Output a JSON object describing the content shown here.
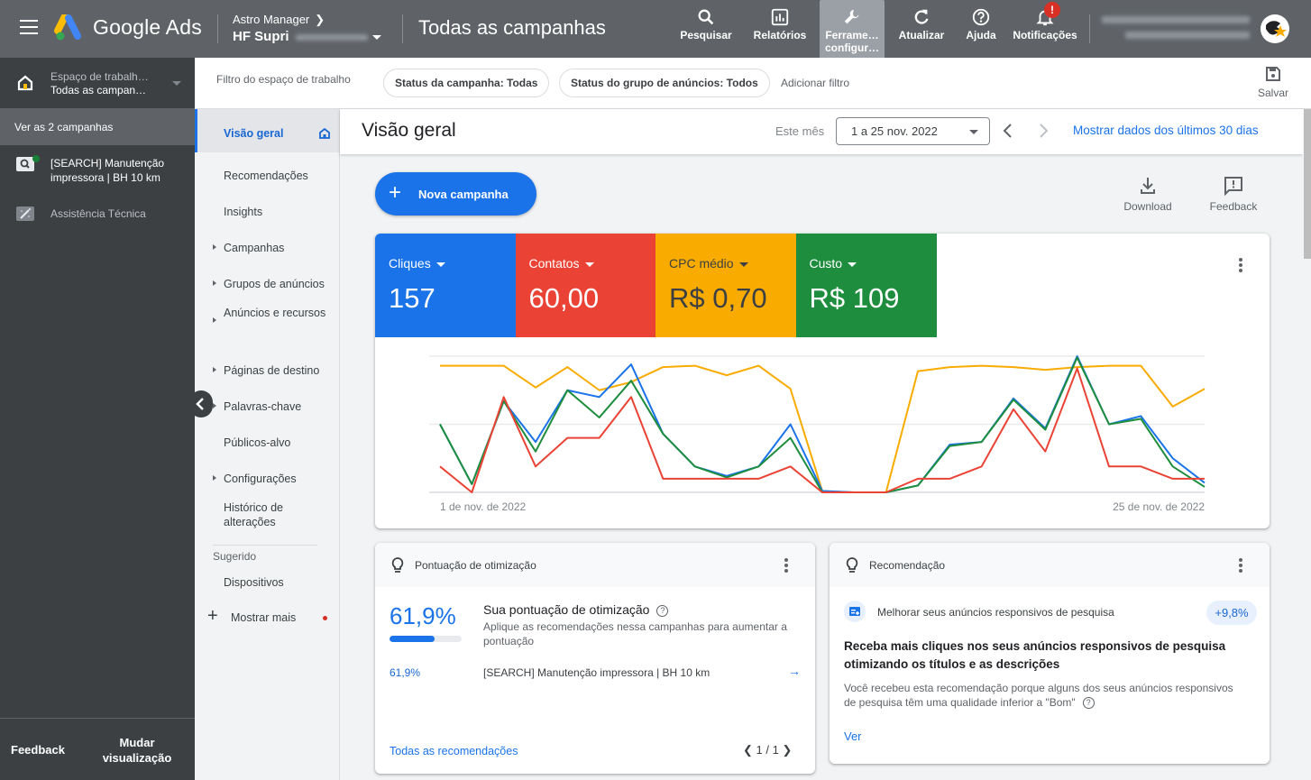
{
  "topbar": {
    "brand": "Google Ads",
    "account_manager": "Astro Manager",
    "account_name": "HF Supri",
    "page_title": "Todas as campanhas",
    "tools": [
      {
        "id": "search",
        "label": "Pesquisar",
        "icon": "search-icon"
      },
      {
        "id": "reports",
        "label": "Relatórios",
        "icon": "bar-chart-icon"
      },
      {
        "id": "tools",
        "label": "Ferrame…",
        "label2": "configur…",
        "icon": "wrench-icon",
        "active": true
      },
      {
        "id": "refresh",
        "label": "Atualizar",
        "icon": "refresh-icon"
      },
      {
        "id": "help",
        "label": "Ajuda",
        "icon": "help-icon"
      },
      {
        "id": "notifications",
        "label": "Notificações",
        "icon": "bell-icon",
        "badge": "!"
      }
    ]
  },
  "leftnav": {
    "workspace_label": "Espaço de trabalh…",
    "workspace_value": "Todas as campan…",
    "all_campaigns": "Ver as 2 campanhas",
    "campaigns": [
      {
        "name": "[SEARCH] Manutenção impressora | BH 10 km",
        "status": "active",
        "icon": "search-campaign-icon"
      },
      {
        "name": "Assistência Técnica",
        "status": "paused",
        "icon": "smart-campaign-icon"
      }
    ],
    "footer": {
      "feedback": "Feedback",
      "change_view": "Mudar visualização"
    }
  },
  "filterbar": {
    "label": "Filtro do espaço de trabalho",
    "chips": [
      "Status da campanha: Todas",
      "Status do grupo de anúncios: Todos"
    ],
    "add_filter": "Adicionar filtro",
    "save": "Salvar"
  },
  "subnav": {
    "items": [
      {
        "label": "Visão geral",
        "active": true,
        "expandable": false
      },
      {
        "label": "Recomendações",
        "expandable": false
      },
      {
        "label": "Insights",
        "expandable": false
      },
      {
        "label": "Campanhas",
        "expandable": true
      },
      {
        "label": "Grupos de anúncios",
        "expandable": true
      },
      {
        "label": "Anúncios e recursos",
        "expandable": true
      },
      {
        "label": "Páginas de destino",
        "expandable": true
      },
      {
        "label": "Palavras-chave",
        "expandable": true
      },
      {
        "label": "Públicos-alvo",
        "expandable": false
      },
      {
        "label": "Configurações",
        "expandable": true
      },
      {
        "label": "Histórico de alterações",
        "expandable": false
      }
    ],
    "suggested_label": "Sugerido",
    "suggested": [
      {
        "label": "Dispositivos"
      }
    ],
    "show_more": "Mostrar mais"
  },
  "main": {
    "title": "Visão geral",
    "range_label": "Este mês",
    "date_range": "1 a 25 nov. 2022",
    "last30": "Mostrar dados dos últimos 30 dias",
    "new_campaign": "Nova campanha",
    "download": "Download",
    "feedback": "Feedback"
  },
  "metrics": [
    {
      "name": "Cliques",
      "value": "157",
      "color": "#1a73e8",
      "text_color": "#ffffff"
    },
    {
      "name": "Contatos",
      "value": "60,00",
      "color": "#ea4335",
      "text_color": "#ffffff"
    },
    {
      "name": "CPC médio",
      "value": "R$ 0,70",
      "color": "#f9ab00",
      "text_color": "#3c4043"
    },
    {
      "name": "Custo",
      "value": "R$ 109",
      "color": "#1e8e3e",
      "text_color": "#ffffff"
    }
  ],
  "chart_data": {
    "type": "line",
    "title": "",
    "xlabel": "",
    "ylabel": "",
    "x_tick_labels": [
      "1 de nov. de 2022",
      "25 de nov. de 2022"
    ],
    "x": [
      1,
      2,
      3,
      4,
      5,
      6,
      7,
      8,
      9,
      10,
      11,
      12,
      13,
      14,
      15,
      16,
      17,
      18,
      19,
      20,
      21,
      22,
      23,
      24,
      25
    ],
    "ylim": [
      0,
      100
    ],
    "y_unit": "relative (each series normalized, no axis labels shown)",
    "grid": true,
    "series": [
      {
        "name": "CPC médio",
        "color": "#f9ab00",
        "values": [
          93,
          93,
          93,
          77,
          92,
          75,
          81,
          92,
          93,
          86,
          93,
          76,
          1,
          0,
          0,
          89,
          92,
          93,
          92,
          90,
          92,
          93,
          93,
          63,
          76
        ]
      },
      {
        "name": "Cliques",
        "color": "#1a73e8",
        "values": [
          50,
          6,
          67,
          37,
          75,
          70,
          94,
          43,
          19,
          12,
          19,
          50,
          1,
          0,
          0,
          5,
          35,
          37,
          69,
          47,
          100,
          50,
          56,
          25,
          7
        ]
      },
      {
        "name": "Custo",
        "color": "#1e8e3e",
        "values": [
          50,
          6,
          67,
          30,
          75,
          55,
          82,
          43,
          19,
          11,
          19,
          40,
          0,
          0,
          0,
          5,
          34,
          37,
          68,
          46,
          99,
          50,
          54,
          19,
          4
        ]
      },
      {
        "name": "Contatos",
        "color": "#ea4335",
        "values": [
          19,
          0,
          70,
          19,
          40,
          40,
          70,
          10,
          10,
          10,
          10,
          19,
          0,
          0,
          0,
          10,
          10,
          19,
          61,
          30,
          91,
          19,
          19,
          10,
          10
        ]
      }
    ]
  },
  "optimization": {
    "header": "Pontuação de otimização",
    "score": "61,9%",
    "score_fraction": 0.619,
    "title": "Sua pontuação de otimização",
    "description": "Aplique as recomendações nessa campanhas para aumentar a pontuação",
    "rows": [
      {
        "score": "61,9%",
        "campaign": "[SEARCH] Manutenção impressora | BH 10 km"
      }
    ],
    "all_link": "Todas as recomendações",
    "pager": "1 / 1"
  },
  "recommendation": {
    "header": "Recomendação",
    "type": "Melhorar seus anúncios responsivos de pesquisa",
    "uplift": "+9,8%",
    "title": "Receba mais cliques nos seus anúncios responsivos de pesquisa otimizando os títulos e as descrições",
    "description": "Você recebeu esta recomendação porque alguns dos seus anúncios responsivos de pesquisa têm uma qualidade inferior a \"Bom\"",
    "view": "Ver"
  }
}
